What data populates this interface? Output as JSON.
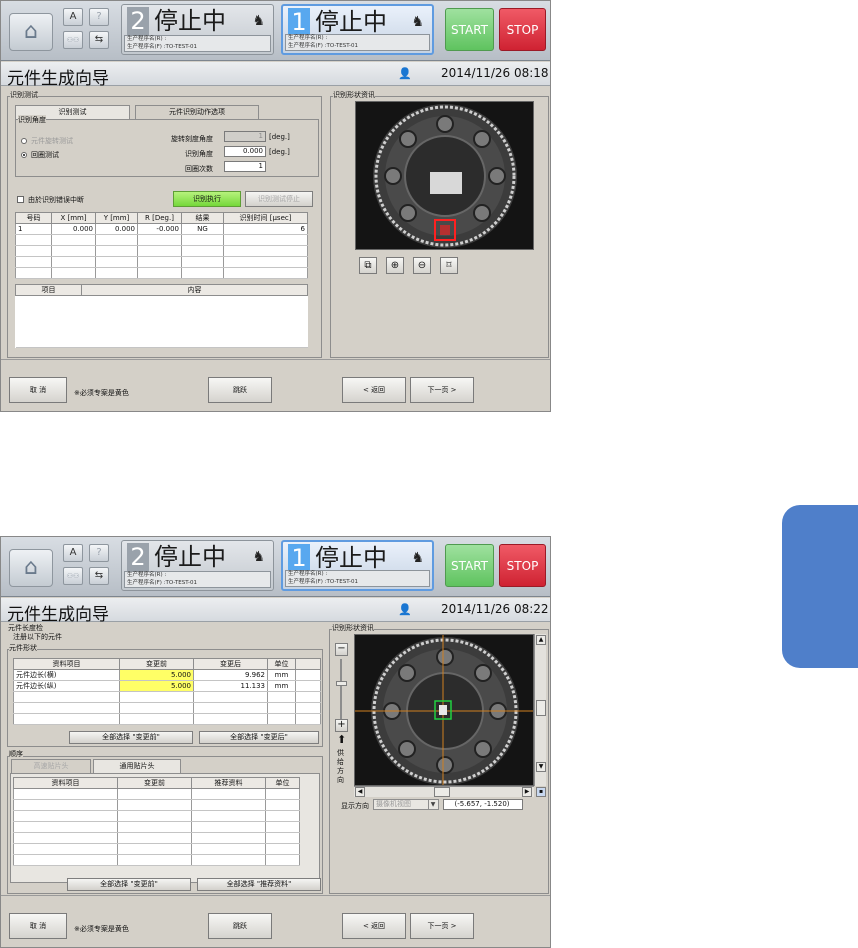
{
  "shared": {
    "header": {
      "lane2": {
        "num": "2",
        "status": "停止中",
        "prog_r": "生产程序名(R) :",
        "prog_f": "生产程序名(F) :TO-TEST-01"
      },
      "lane1": {
        "num": "1",
        "status": "停止中",
        "prog_r": "生产程序名(R) :",
        "prog_f": "生产程序名(F) :TO-TEST-01"
      },
      "start": "START",
      "stop": "STOP",
      "help": "?",
      "a_icon": "A"
    },
    "title": "元件生成向导",
    "bottom": {
      "cancel": "取 消",
      "note": "※必须专案是黄色",
      "skip": "跳跃",
      "back": "< 返回",
      "next": "下一页 >"
    },
    "accent": "#4f7fca"
  },
  "screen1": {
    "datetime": "2014/11/26 08:18",
    "section": "识别测试",
    "tabs": [
      "识别测试",
      "元件识别动作选项"
    ],
    "angle_group": "识别角度",
    "radio1": "元件旋转测试",
    "radio2": "回圈测试",
    "rot_angle_label": "旋转刻度角度",
    "rot_angle_value": "1",
    "rot_angle_unit": "[deg.]",
    "rec_angle_label": "识别角度",
    "rec_angle_value": "0.000",
    "rec_angle_unit": "[deg.]",
    "loop_label": "回圈次数",
    "loop_value": "1",
    "stop_on_error": "由於识别错误中断",
    "exec_btn": "识别执行",
    "stop_btn": "识别测试停止",
    "table_headers": [
      "号码",
      "X [mm]",
      "Y [mm]",
      "R [Deg.]",
      "结果",
      "识别时间 [μsec]"
    ],
    "table_rows": [
      [
        "1",
        "0.000",
        "0.000",
        "-0.000",
        "NG",
        "6"
      ]
    ],
    "table2_headers": [
      "项目",
      "内容"
    ],
    "shape_info": "识别形状资讯"
  },
  "screen2": {
    "datetime": "2014/11/26 08:22",
    "section": "元件长度检",
    "register_text": "注册以下的元件",
    "shape_group": "元件形状",
    "t1_headers": [
      "资料项目",
      "变更前",
      "变更后",
      "单位"
    ],
    "t1_rows": [
      [
        "元件边长(横)",
        "5.000",
        "9.962",
        "mm"
      ],
      [
        "元件边长(纵)",
        "5.000",
        "11.133",
        "mm"
      ]
    ],
    "select_before": "全部选择 \"变更前\"",
    "select_after": "全部选择 \"变更后\"",
    "order_group": "顺序",
    "tabs": [
      "高速贴片头",
      "通用贴片头"
    ],
    "t2_headers": [
      "资料项目",
      "变更前",
      "推荐资料",
      "单位"
    ],
    "select_before2": "全部选择 \"变更前\"",
    "select_recommended": "全部选择 \"推荐资料\"",
    "shape_info": "识别形状资讯",
    "feed_direction": "供给方向",
    "display_dir_label": "显示方向",
    "display_dir_value": "摄像机视图",
    "coords": "(-5.657, -1.520)"
  }
}
